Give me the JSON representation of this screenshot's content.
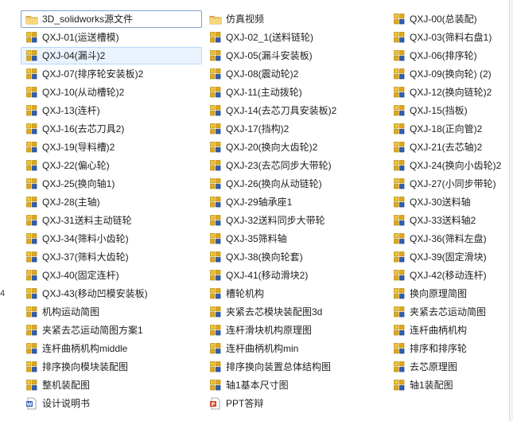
{
  "edge_text": "4",
  "items": [
    {
      "label": "3D_solidworks源文件",
      "icon": "folder-icon",
      "selected": true
    },
    {
      "label": "QXJ-01(运送槽模)",
      "icon": "assembly-icon"
    },
    {
      "label": "QXJ-04(漏斗)2",
      "icon": "assembly-icon",
      "hover": true
    },
    {
      "label": "QXJ-07(排序轮安装板)2",
      "icon": "assembly-icon"
    },
    {
      "label": "QXJ-10(从动槽轮)2",
      "icon": "assembly-icon"
    },
    {
      "label": "QXJ-13(连杆)",
      "icon": "assembly-icon"
    },
    {
      "label": "QXJ-16(去芯刀具2)",
      "icon": "assembly-icon"
    },
    {
      "label": "QXJ-19(导料槽)2",
      "icon": "assembly-icon"
    },
    {
      "label": "QXJ-22(偏心轮)",
      "icon": "assembly-icon"
    },
    {
      "label": "QXJ-25(换向轴1)",
      "icon": "assembly-icon"
    },
    {
      "label": "QXJ-28(主轴)",
      "icon": "assembly-icon"
    },
    {
      "label": "QXJ-31送料主动链轮",
      "icon": "assembly-icon"
    },
    {
      "label": "QXJ-34(筛料小齿轮)",
      "icon": "assembly-icon"
    },
    {
      "label": "QXJ-37(筛料大齿轮)",
      "icon": "assembly-icon"
    },
    {
      "label": "QXJ-40(固定连杆)",
      "icon": "assembly-icon"
    },
    {
      "label": "QXJ-43(移动凹模安装板)",
      "icon": "assembly-icon"
    },
    {
      "label": "机构运动简图",
      "icon": "assembly-icon"
    },
    {
      "label": "夹紧去芯运动简图方案1",
      "icon": "assembly-icon"
    },
    {
      "label": "连杆曲柄机构middle",
      "icon": "assembly-icon"
    },
    {
      "label": "排序换向模块装配图",
      "icon": "assembly-icon"
    },
    {
      "label": "整机装配图",
      "icon": "assembly-icon"
    },
    {
      "label": "设计说明书",
      "icon": "word-doc-icon"
    },
    {
      "label": "仿真视频",
      "icon": "folder-icon"
    },
    {
      "label": "QXJ-02_1(送料链轮)",
      "icon": "assembly-icon"
    },
    {
      "label": "QXJ-05(漏斗安装板)",
      "icon": "assembly-icon"
    },
    {
      "label": "QXJ-08(震动轮)2",
      "icon": "assembly-icon"
    },
    {
      "label": "QXJ-11(主动拨轮)",
      "icon": "assembly-icon"
    },
    {
      "label": "QXJ-14(去芯刀具安装板)2",
      "icon": "assembly-icon"
    },
    {
      "label": "QXJ-17(挡构)2",
      "icon": "assembly-icon"
    },
    {
      "label": "QXJ-20(换向大齿轮)2",
      "icon": "assembly-icon"
    },
    {
      "label": "QXJ-23(去芯同步大带轮)",
      "icon": "assembly-icon"
    },
    {
      "label": "QXJ-26(换向从动链轮)",
      "icon": "assembly-icon"
    },
    {
      "label": "QXJ-29轴承座1",
      "icon": "assembly-icon"
    },
    {
      "label": "QXJ-32送料同步大带轮",
      "icon": "assembly-icon"
    },
    {
      "label": "QXJ-35筛料轴",
      "icon": "assembly-icon"
    },
    {
      "label": "QXJ-38(换向轮套)",
      "icon": "assembly-icon"
    },
    {
      "label": "QXJ-41(移动滑块2)",
      "icon": "assembly-icon"
    },
    {
      "label": "槽轮机构",
      "icon": "assembly-icon"
    },
    {
      "label": "夹紧去芯模块装配图3d",
      "icon": "assembly-icon"
    },
    {
      "label": "连杆滑块机构原理图",
      "icon": "assembly-icon"
    },
    {
      "label": "连杆曲柄机构min",
      "icon": "assembly-icon"
    },
    {
      "label": "排序换向装置总体结构图",
      "icon": "assembly-icon"
    },
    {
      "label": "轴1基本尺寸图",
      "icon": "assembly-icon"
    },
    {
      "label": "PPT答辩",
      "icon": "ppt-icon"
    },
    {
      "label": "QXJ-00(总装配)",
      "icon": "assembly-icon"
    },
    {
      "label": "QXJ-03(筛料右盘1)",
      "icon": "assembly-icon"
    },
    {
      "label": "QXJ-06(排序轮)",
      "icon": "assembly-icon"
    },
    {
      "label": "QXJ-09(换向轮) (2)",
      "icon": "assembly-icon"
    },
    {
      "label": "QXJ-12(换向链轮)2",
      "icon": "assembly-icon"
    },
    {
      "label": "QXJ-15(挡板)",
      "icon": "assembly-icon"
    },
    {
      "label": "QXJ-18(正向管)2",
      "icon": "assembly-icon"
    },
    {
      "label": "QXJ-21(去芯轴)2",
      "icon": "assembly-icon"
    },
    {
      "label": "QXJ-24(换向小齿轮)2",
      "icon": "assembly-icon"
    },
    {
      "label": "QXJ-27(小同步带轮)",
      "icon": "assembly-icon"
    },
    {
      "label": "QXJ-30送料轴",
      "icon": "assembly-icon"
    },
    {
      "label": "QXJ-33送料轴2",
      "icon": "assembly-icon"
    },
    {
      "label": "QXJ-36(筛料左盘)",
      "icon": "assembly-icon"
    },
    {
      "label": "QXJ-39(固定滑块)",
      "icon": "assembly-icon"
    },
    {
      "label": "QXJ-42(移动连杆)",
      "icon": "assembly-icon"
    },
    {
      "label": "换向原理简图",
      "icon": "assembly-icon"
    },
    {
      "label": "夹紧去芯运动简图",
      "icon": "assembly-icon"
    },
    {
      "label": "连杆曲柄机构",
      "icon": "assembly-icon"
    },
    {
      "label": "排序和排序轮",
      "icon": "assembly-icon"
    },
    {
      "label": "去芯原理图",
      "icon": "assembly-icon"
    },
    {
      "label": "轴1装配图",
      "icon": "assembly-icon"
    }
  ]
}
